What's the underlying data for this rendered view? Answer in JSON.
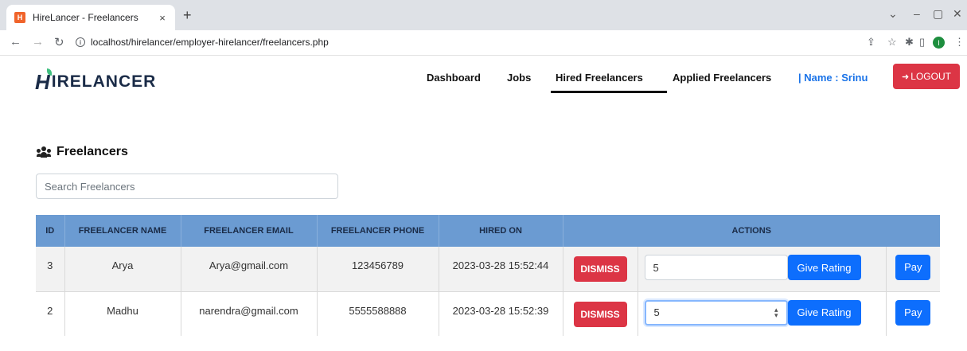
{
  "browser": {
    "tab_title": "HireLancer - Freelancers",
    "tab_close": "×",
    "new_tab": "+",
    "favicon": "H",
    "url": "localhost/hirelancer/employer-hirelancer/freelancers.php",
    "profile_initial": "I",
    "icons": [
      "back-icon",
      "forward-icon",
      "reload-icon",
      "info-icon",
      "share-icon",
      "star-icon",
      "extensions-icon",
      "sidepanel-icon",
      "menu-icon"
    ]
  },
  "nav": {
    "logo_mark": "H",
    "logo_text": "IRELANCER",
    "links": [
      {
        "label": "Dashboard"
      },
      {
        "label": "Jobs"
      },
      {
        "label": "Hired Freelancers"
      },
      {
        "label": "Applied Freelancers"
      }
    ],
    "name_label": "| Name : Srinu",
    "logout_label": "LOGOUT"
  },
  "page": {
    "title": "Freelancers",
    "search_placeholder": "Search Freelancers"
  },
  "table": {
    "headers": [
      "ID",
      "FREELANCER NAME",
      "FREELANCER EMAIL",
      "FREELANCER PHONE",
      "HIRED ON",
      "ACTIONS"
    ],
    "rows": [
      {
        "id": "3",
        "name": "Arya",
        "email": "Arya@gmail.com",
        "phone": "123456789",
        "hired_on": "2023-03-28 15:52:44",
        "dismiss": "DISMISS",
        "rating": "5",
        "rate_label": "Give Rating",
        "pay_label": "Pay"
      },
      {
        "id": "2",
        "name": "Madhu",
        "email": "narendra@gmail.com",
        "phone": "5555588888",
        "hired_on": "2023-03-28 15:52:39",
        "dismiss": "DISMISS",
        "rating": "5",
        "rate_label": "Give Rating",
        "pay_label": "Pay"
      }
    ]
  },
  "colors": {
    "header_bg": "#6b9bd2",
    "danger": "#dc3545",
    "primary": "#0d6efd",
    "name_accent": "#1a73e8"
  }
}
